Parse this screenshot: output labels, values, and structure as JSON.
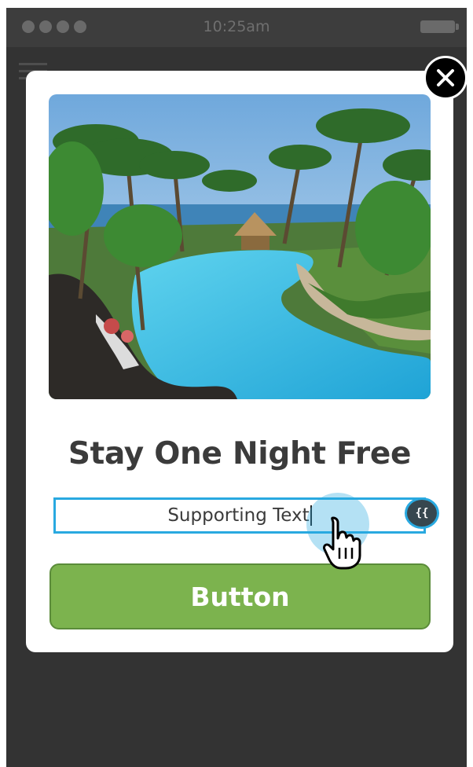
{
  "status_bar": {
    "time": "10:25am",
    "signal_icon": "signal-dots-icon",
    "battery_icon": "battery-icon"
  },
  "nav": {
    "menu_icon": "hamburger-menu-icon"
  },
  "modal": {
    "close_icon": "close-icon",
    "hero_image": "resort-pool-photo",
    "headline": "Stay One Night Free",
    "supporting_text": "Supporting Text",
    "merge_tag_label": "{{",
    "button_label": "Button"
  },
  "colors": {
    "phone_background": "#333333",
    "accent_border": "#29a9e0",
    "button_green": "#7cb34e",
    "headline_text": "#3b3b3b"
  },
  "cursor": "hand-pointer-icon"
}
